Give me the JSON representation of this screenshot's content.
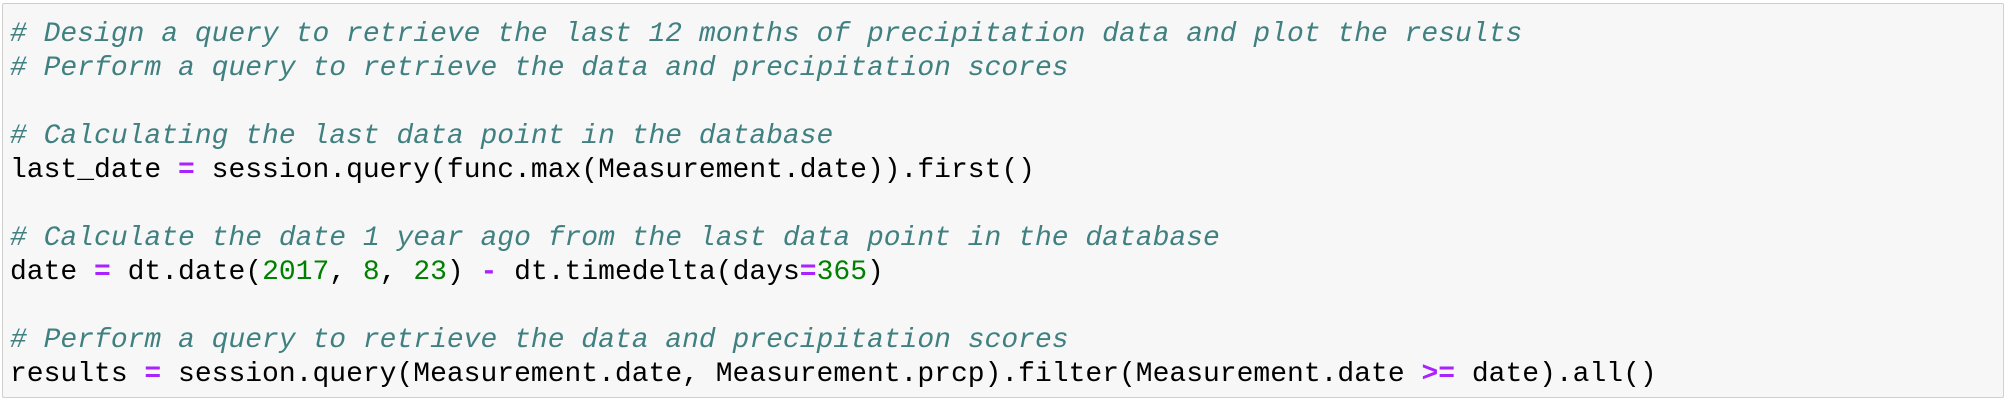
{
  "code_cell": {
    "line_1": "# Design a query to retrieve the last 12 months of precipitation data and plot the results",
    "line_2": "# Perform a query to retrieve the data and precipitation scores",
    "line_4": "# Calculating the last data point in the database",
    "line_5": {
      "t1": "last_date ",
      "op1": "=",
      "t2": " session.query(func.max(Measurement.date)).first()"
    },
    "line_7": "# Calculate the date 1 year ago from the last data point in the database",
    "line_8": {
      "t1": "date ",
      "op1": "=",
      "t2": " dt.date(",
      "n1": "2017",
      "t3": ", ",
      "n2": "8",
      "t4": ", ",
      "n3": "23",
      "t5": ") ",
      "op2": "-",
      "t6": " dt.timedelta(days",
      "op3": "=",
      "n4": "365",
      "t7": ")"
    },
    "line_10": "# Perform a query to retrieve the data and precipitation scores",
    "line_11": {
      "t1": "results ",
      "op1": "=",
      "t2": " session.query(Measurement.date, Measurement.prcp).filter(Measurement.date ",
      "op2": ">=",
      "t3": " date).all()"
    }
  }
}
